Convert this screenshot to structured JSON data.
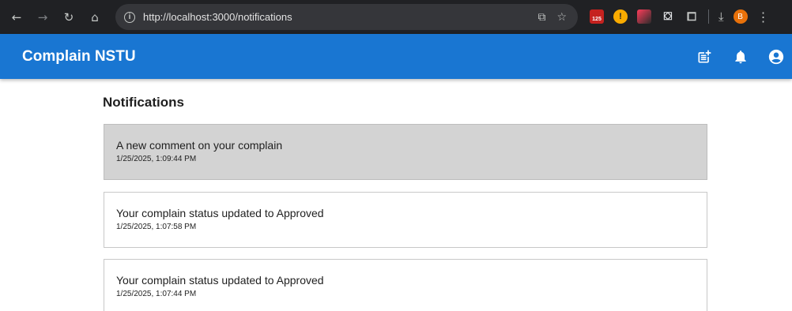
{
  "browser": {
    "url": "http://localhost:3000/notifications",
    "extensions": {
      "calendar_badge": "125",
      "profile_initial": "B"
    }
  },
  "app": {
    "title": "Complain NSTU"
  },
  "page": {
    "heading": "Notifications"
  },
  "notifications": [
    {
      "message": "A new comment on your complain",
      "time": "1/25/2025, 1:09:44 PM",
      "unread": true
    },
    {
      "message": "Your complain status updated to Approved",
      "time": "1/25/2025, 1:07:58 PM",
      "unread": false
    },
    {
      "message": "Your complain status updated to Approved",
      "time": "1/25/2025, 1:07:44 PM",
      "unread": false
    }
  ],
  "colors": {
    "app_bar": "#1976d2",
    "unread_bg": "#d3d3d3",
    "browser_bg": "#202124"
  }
}
